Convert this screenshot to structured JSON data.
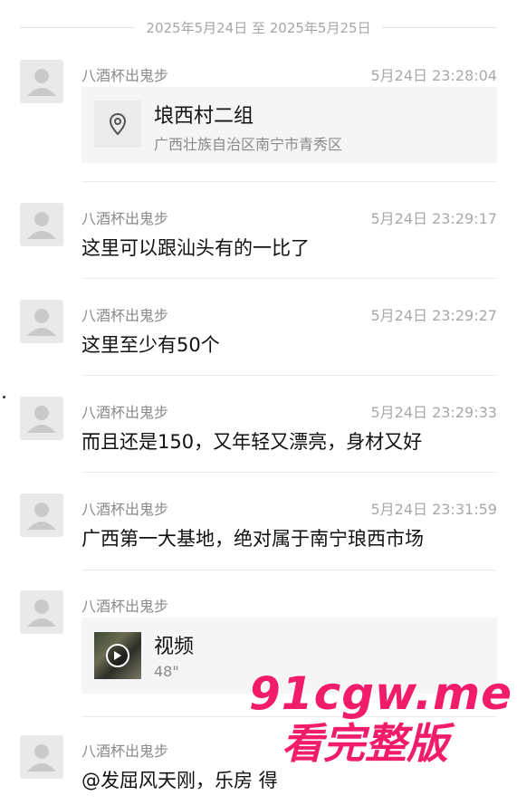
{
  "date_range": "2025年5月24日 至 2025年5月25日",
  "messages": [
    {
      "sender": "八酒杯出鬼步",
      "time": "5月24日 23:28:04",
      "type": "location",
      "location": {
        "title": "埌西村二组",
        "address": "广西壮族自治区南宁市青秀区"
      }
    },
    {
      "sender": "八酒杯出鬼步",
      "time": "5月24日 23:29:17",
      "type": "text",
      "text": "这里可以跟汕头有的一比了"
    },
    {
      "sender": "八酒杯出鬼步",
      "time": "5月24日 23:29:27",
      "type": "text",
      "text": "这里至少有50个"
    },
    {
      "sender": "八酒杯出鬼步",
      "time": "5月24日 23:29:33",
      "type": "text",
      "text": "而且还是150，又年轻又漂亮，身材又好"
    },
    {
      "sender": "八酒杯出鬼步",
      "time": "5月24日 23:31:59",
      "type": "text",
      "text": "广西第一大基地，绝对属于南宁琅西市场"
    },
    {
      "sender": "八酒杯出鬼步",
      "time": "",
      "type": "video",
      "video": {
        "title": "视频",
        "duration": "48\""
      }
    },
    {
      "sender": "八酒杯出鬼步",
      "time": "",
      "type": "text",
      "text": "@发屈风天刚，乐房 得"
    }
  ],
  "watermark": {
    "domain": "91cgw.me",
    "subtitle": "看完整版"
  },
  "icons": {
    "avatar": "default-person-avatar-icon",
    "location": "map-pin-icon",
    "play": "play-icon"
  }
}
